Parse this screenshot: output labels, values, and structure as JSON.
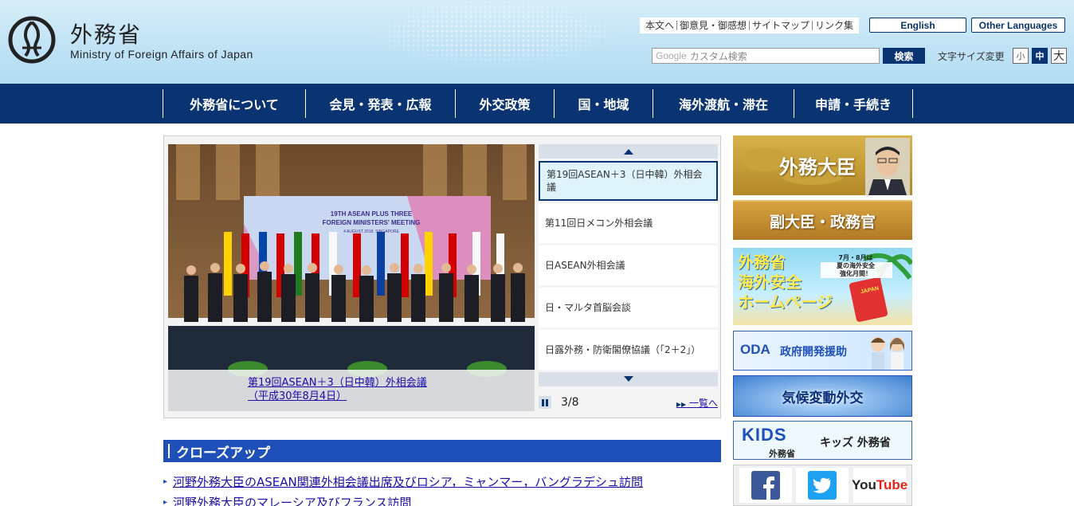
{
  "header": {
    "logo_title": "外務省",
    "logo_subtitle": "Ministry of Foreign Affairs of Japan",
    "util_links": [
      "本文へ",
      "御意見・御感想",
      "サイトマップ",
      "リンク集"
    ],
    "lang_english": "English",
    "lang_other": "Other Languages",
    "search_placeholder_brand": "Google",
    "search_placeholder": "カスタム検索",
    "search_button": "検索",
    "font_size_label": "文字サイズ変更",
    "font_sizes": [
      "小",
      "中",
      "大"
    ]
  },
  "nav": {
    "items": [
      "外務省について",
      "会見・発表・広報",
      "外交政策",
      "国・地域",
      "海外渡航・滞在",
      "申請・手続き"
    ]
  },
  "slider": {
    "backdrop_title": "19TH ASEAN PLUS THREE\nFOREIGN MINISTERS' MEETING",
    "backdrop_sub": "4 AUGUST 2018, SINGAPORE",
    "caption_line1": "第19回ASEAN＋3（日中韓）外相会議",
    "caption_line2": "（平成30年8月4日）",
    "thumbs": [
      "第19回ASEAN＋3（日中韓）外相会議",
      "第11回日メコン外相会議",
      "日ASEAN外相会議",
      "日・マルタ首脳会談",
      "日露外務・防衛閣僚協議（「2＋2」）"
    ],
    "counter": "3/8",
    "list_link": "一覧へ"
  },
  "closeup": {
    "heading": "クローズアップ",
    "items": [
      "河野外務大臣のASEAN関連外相会議出席及びロシア，ミャンマー，バングラデシュ訪問",
      "河野外務大臣のマレーシア及びフランス訪問"
    ]
  },
  "sidebar": {
    "minister": "外務大臣",
    "vice": "副大臣・政務官",
    "safety_title_1": "外務省",
    "safety_title_2": "海外安全",
    "safety_title_3": "ホームページ",
    "safety_note": "7月・8月は\n夏の海外安全\n強化月間！",
    "safety_badge": "JAPAN",
    "oda_abbr": "ODA",
    "oda_text": "政府開発援助",
    "climate": "気候変動外交",
    "kids_logo": "KIDS",
    "kids_logo_sub": "外務省",
    "kids_text": "キッズ 外務省",
    "social": [
      "facebook-icon",
      "twitter-icon",
      "youtube-icon"
    ],
    "youtube_text": "YouTube"
  },
  "colors": {
    "navy": "#0a3471",
    "closeup_blue": "#1f50b9",
    "header_sky": "#bfe2f5",
    "link": "#1a0dab"
  }
}
